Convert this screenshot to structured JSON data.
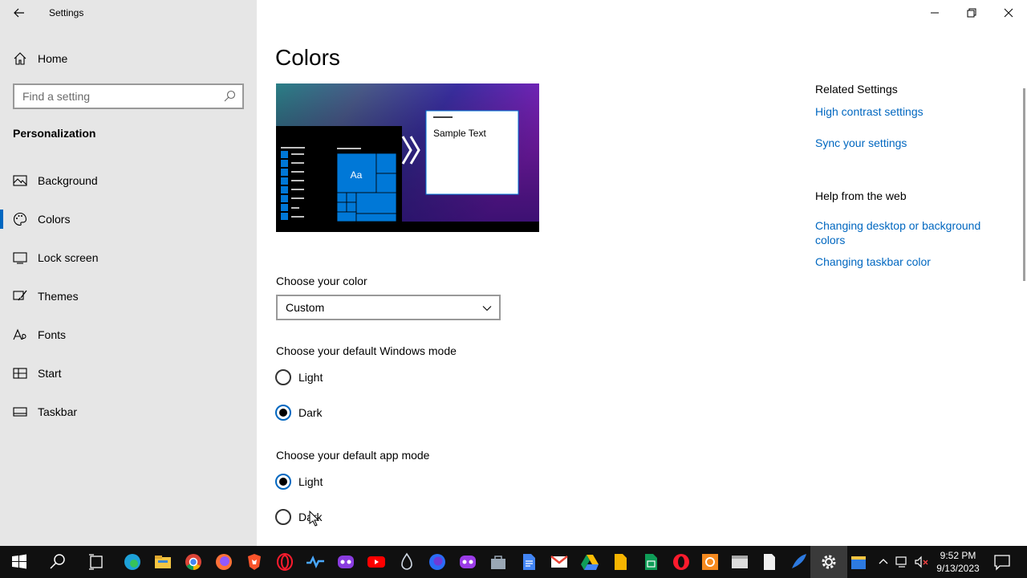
{
  "window": {
    "title": "Settings",
    "controls": {
      "minimize": "minimize",
      "maximize": "restore",
      "close": "close"
    }
  },
  "sidebar": {
    "home_label": "Home",
    "search_placeholder": "Find a setting",
    "section_title": "Personalization",
    "items": [
      {
        "label": "Background",
        "icon": "image-icon",
        "active": false
      },
      {
        "label": "Colors",
        "icon": "palette-icon",
        "active": true
      },
      {
        "label": "Lock screen",
        "icon": "lock-screen-icon",
        "active": false
      },
      {
        "label": "Themes",
        "icon": "brush-icon",
        "active": false
      },
      {
        "label": "Fonts",
        "icon": "font-icon",
        "active": false
      },
      {
        "label": "Start",
        "icon": "start-grid-icon",
        "active": false
      },
      {
        "label": "Taskbar",
        "icon": "taskbar-icon",
        "active": false
      }
    ]
  },
  "main": {
    "title": "Colors",
    "preview": {
      "sample_text": "Sample Text",
      "tile_text": "Aa",
      "accent": "#0078d7"
    },
    "choose_color": {
      "label": "Choose your color",
      "selected": "Custom"
    },
    "windows_mode": {
      "label": "Choose your default Windows mode",
      "options": [
        {
          "label": "Light",
          "checked": false
        },
        {
          "label": "Dark",
          "checked": true
        }
      ]
    },
    "app_mode": {
      "label": "Choose your default app mode",
      "options": [
        {
          "label": "Light",
          "checked": true
        },
        {
          "label": "Dark",
          "checked": false
        }
      ]
    }
  },
  "related": {
    "heading": "Related Settings",
    "links": [
      "High contrast settings",
      "Sync your settings"
    ],
    "help_heading": "Help from the web",
    "help_links": [
      "Changing desktop or background colors",
      "Changing taskbar color"
    ]
  },
  "taskbar": {
    "time": "9:52 PM",
    "date": "9/13/2023"
  },
  "colors": {
    "accent": "#0067c0",
    "sidebar_bg": "#e6e6e6",
    "taskbar_bg": "#101010"
  }
}
